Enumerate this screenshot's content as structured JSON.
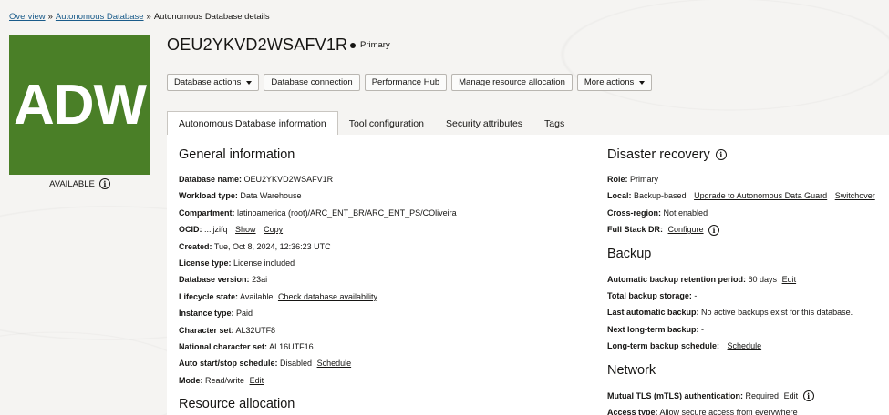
{
  "breadcrumb": {
    "overview": "Overview",
    "autonomous_database": "Autonomous Database",
    "current": "Autonomous Database details",
    "sep": "»"
  },
  "logo": {
    "text": "ADW",
    "color": "#4a7f27"
  },
  "status": {
    "text": "AVAILABLE"
  },
  "title": "OEU2YKVD2WSAFV1R",
  "role_badge": "Primary",
  "actions": {
    "database_actions": "Database actions",
    "database_connection": "Database connection",
    "performance_hub": "Performance Hub",
    "manage_resource_allocation": "Manage resource allocation",
    "more_actions": "More actions"
  },
  "tabs": [
    {
      "label": "Autonomous Database information"
    },
    {
      "label": "Tool configuration"
    },
    {
      "label": "Security attributes"
    },
    {
      "label": "Tags"
    }
  ],
  "general": {
    "heading": "General information",
    "database_name": {
      "label": "Database name:",
      "value": "OEU2YKVD2WSAFV1R"
    },
    "workload_type": {
      "label": "Workload type:",
      "value": "Data Warehouse"
    },
    "compartment": {
      "label": "Compartment:",
      "value": "latinoamerica (root)/ARC_ENT_BR/ARC_ENT_PS/COliveira"
    },
    "ocid": {
      "label": "OCID:",
      "value": "...ljzifq",
      "show": "Show",
      "copy": "Copy"
    },
    "created": {
      "label": "Created:",
      "value": "Tue, Oct 8, 2024, 12:36:23 UTC"
    },
    "license_type": {
      "label": "License type:",
      "value": "License included"
    },
    "database_version": {
      "label": "Database version:",
      "value": "23ai"
    },
    "lifecycle_state": {
      "label": "Lifecycle state:",
      "value": "Available",
      "link": "Check database availability"
    },
    "instance_type": {
      "label": "Instance type:",
      "value": "Paid"
    },
    "character_set": {
      "label": "Character set:",
      "value": "AL32UTF8"
    },
    "national_character_set": {
      "label": "National character set:",
      "value": "AL16UTF16"
    },
    "auto_start_stop": {
      "label": "Auto start/stop schedule:",
      "value": "Disabled",
      "link": "Schedule"
    },
    "mode": {
      "label": "Mode:",
      "value": "Read/write",
      "link": "Edit"
    }
  },
  "resource_allocation": {
    "heading": "Resource allocation"
  },
  "disaster_recovery": {
    "heading": "Disaster recovery",
    "role": {
      "label": "Role:",
      "value": "Primary"
    },
    "local": {
      "label": "Local:",
      "value": "Backup-based",
      "link1": "Upgrade to Autonomous Data Guard",
      "link2": "Switchover"
    },
    "cross_region": {
      "label": "Cross-region:",
      "value": "Not enabled"
    },
    "full_stack_dr": {
      "label": "Full Stack DR:",
      "link": "Configure"
    }
  },
  "backup": {
    "heading": "Backup",
    "retention": {
      "label": "Automatic backup retention period:",
      "value": "60 days",
      "link": "Edit"
    },
    "total_storage": {
      "label": "Total backup storage:",
      "value": "-"
    },
    "last_automatic": {
      "label": "Last automatic backup:",
      "value": "No active backups exist for this database."
    },
    "next_long_term": {
      "label": "Next long-term backup:",
      "value": "-"
    },
    "long_term_schedule": {
      "label": "Long-term backup schedule:",
      "link": "Schedule"
    }
  },
  "network": {
    "heading": "Network",
    "mtls": {
      "label": "Mutual TLS (mTLS) authentication:",
      "value": "Required",
      "link": "Edit"
    },
    "access_type": {
      "label": "Access type:",
      "value": "Allow secure access from everywhere"
    }
  }
}
